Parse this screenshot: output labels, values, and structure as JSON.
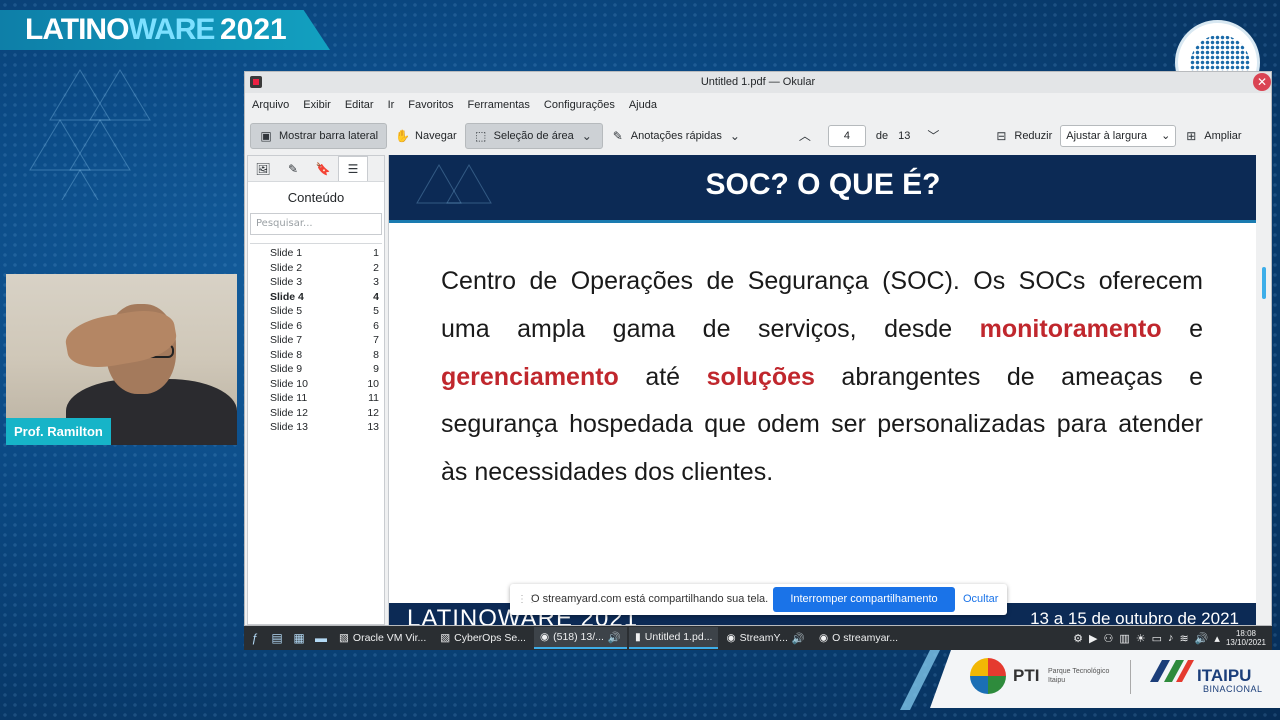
{
  "event": {
    "logo_prefix": "LATINO",
    "logo_highlight": "WARE",
    "logo_year": "2021"
  },
  "presenter": {
    "name": "Prof. Ramilton"
  },
  "window": {
    "title": "Untitled 1.pdf — Okular",
    "close_glyph": "✕"
  },
  "menu": [
    "Arquivo",
    "Exibir",
    "Editar",
    "Ir",
    "Favoritos",
    "Ferramentas",
    "Configurações",
    "Ajuda"
  ],
  "toolbar": {
    "sidebar_toggle": "Mostrar barra lateral",
    "browse": "Navegar",
    "area_select": "Seleção de área",
    "quick_annotations": "Anotações rápidas",
    "page_current": "4",
    "page_of": "de",
    "page_total": "13",
    "zoom_out": "Reduzir",
    "fit_mode": "Ajustar à largura",
    "zoom_in": "Ampliar"
  },
  "sidebar": {
    "title": "Conteúdo",
    "search_placeholder": "Pesquisar...",
    "current_index": 3,
    "slides": [
      {
        "label": "Slide 1",
        "page": "1"
      },
      {
        "label": "Slide 2",
        "page": "2"
      },
      {
        "label": "Slide 3",
        "page": "3"
      },
      {
        "label": "Slide 4",
        "page": "4"
      },
      {
        "label": "Slide 5",
        "page": "5"
      },
      {
        "label": "Slide 6",
        "page": "6"
      },
      {
        "label": "Slide 7",
        "page": "7"
      },
      {
        "label": "Slide 8",
        "page": "8"
      },
      {
        "label": "Slide 9",
        "page": "9"
      },
      {
        "label": "Slide 10",
        "page": "10"
      },
      {
        "label": "Slide 11",
        "page": "11"
      },
      {
        "label": "Slide 12",
        "page": "12"
      },
      {
        "label": "Slide 13",
        "page": "13"
      }
    ]
  },
  "slide": {
    "title": "SOC? O QUE É?",
    "body_1": "Centro de Operações de Segurança (SOC). Os SOCs oferecem uma ampla gama de serviços, desde ",
    "hl_1": "monitoramento",
    "body_2": " e ",
    "hl_2": "gerenciamento",
    "body_3": " até ",
    "hl_3": "soluções",
    "body_4": " abrangentes de ameaças e segurança hospedada que odem ser personalizadas para atender às necessidades dos clientes.",
    "footer_left": "LATINOWARE 2021",
    "footer_right": "13 a 15 de outubro de 2021"
  },
  "share_notice": {
    "message": "O streamyard.com está compartilhando sua tela.",
    "stop_button": "Interromper compartilhamento",
    "hide_link": "Ocultar"
  },
  "taskbar": {
    "tasks": [
      "Oracle VM Vir...",
      "CyberOps Se...",
      "(518) 13/...",
      "Untitled 1.pd...",
      "StreamY...",
      "O streamyar..."
    ],
    "time": "18:08",
    "date": "13/10/2021"
  },
  "sponsors": {
    "pti": "PTI",
    "pti_sub": "Parque Tecnológico Itaipu",
    "itaipu": "ITAIPU",
    "itaipu_sub": "BINACIONAL"
  },
  "colors": {
    "highlight_red": "#c0272d",
    "slide_navy": "#0c2a55",
    "accent_blue": "#3daee9",
    "share_blue": "#1a73e8"
  }
}
